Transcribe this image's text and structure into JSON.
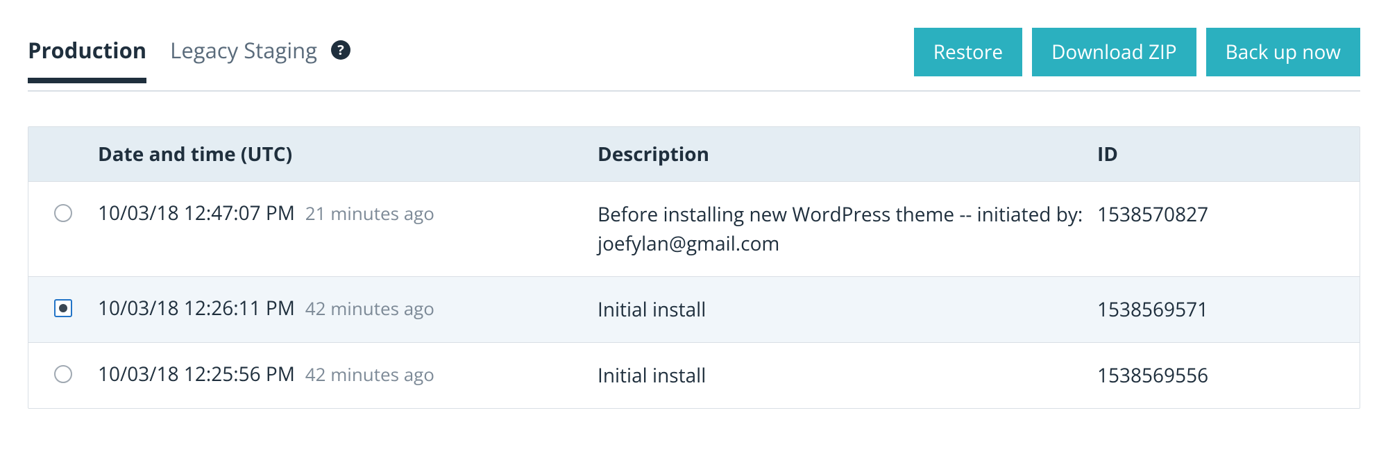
{
  "tabs": {
    "production": "Production",
    "legacy_staging": "Legacy Staging"
  },
  "actions": {
    "restore": "Restore",
    "download_zip": "Download ZIP",
    "backup_now": "Back up now"
  },
  "table": {
    "headers": {
      "date": "Date and time (UTC)",
      "description": "Description",
      "id": "ID"
    },
    "rows": [
      {
        "datetime": "10/03/18 12:47:07 PM",
        "relative": "21 minutes ago",
        "description": "Before installing new WordPress theme -- initiated by: joefylan@gmail.com",
        "id": "1538570827",
        "selected": false
      },
      {
        "datetime": "10/03/18 12:26:11 PM",
        "relative": "42 minutes ago",
        "description": "Initial install",
        "id": "1538569571",
        "selected": true
      },
      {
        "datetime": "10/03/18 12:25:56 PM",
        "relative": "42 minutes ago",
        "description": "Initial install",
        "id": "1538569556",
        "selected": false
      }
    ]
  }
}
